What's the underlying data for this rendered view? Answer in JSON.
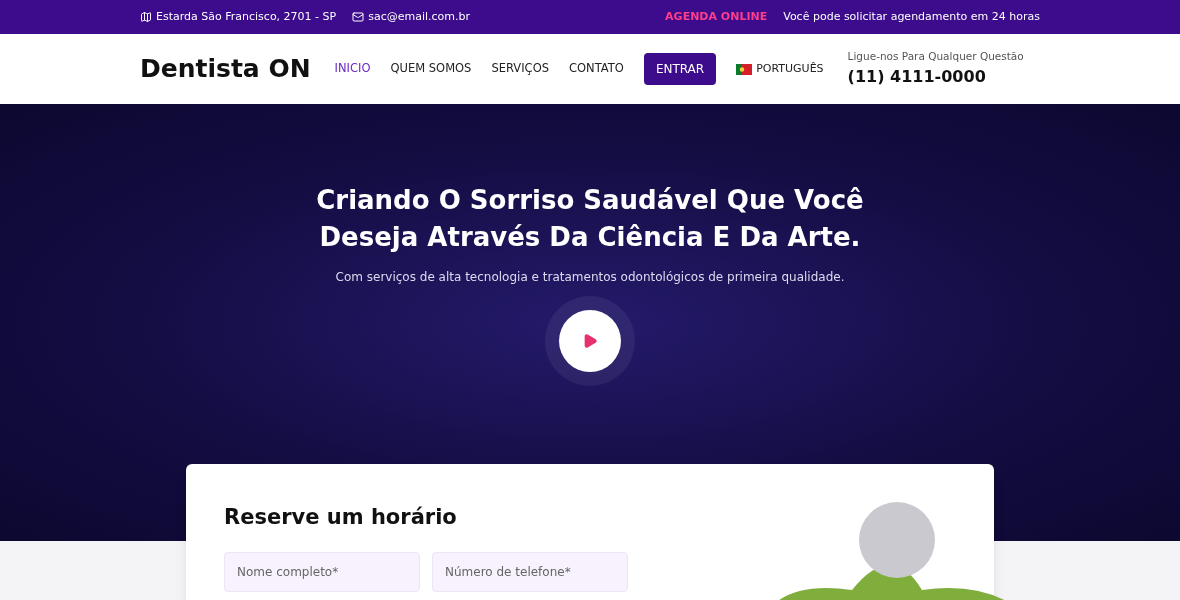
{
  "topbar": {
    "address": "Estarda São Francisco, 2701 - SP",
    "email": "sac@email.com.br",
    "agenda_label": "AGENDA ONLINE",
    "agenda_text": "Você pode solicitar agendamento em 24 horas"
  },
  "header": {
    "logo": "Dentista ON",
    "nav": [
      {
        "label": "INICIO",
        "selected": true
      },
      {
        "label": "QUEM SOMOS",
        "selected": false
      },
      {
        "label": "SERVIÇOS",
        "selected": false
      },
      {
        "label": "CONTATO",
        "selected": false
      }
    ],
    "login_button": "ENTRAR",
    "language": "PORTUGUÊS",
    "contact_caption": "Ligue-nos Para Qualquer Questão",
    "phone": "(11) 4111-0000"
  },
  "hero": {
    "title_lines": [
      "Criando O Sorriso Saudável Que Você",
      "Deseja Através Da Ciência E Da Arte."
    ],
    "subtitle": "Com serviços de alta tecnologia e tratamentos odontológicos de primeira qualidade."
  },
  "booking": {
    "title": "Reserve um horário",
    "fields": [
      {
        "placeholder": "Nome completo*"
      },
      {
        "placeholder": "Número de telefone*"
      }
    ]
  }
}
